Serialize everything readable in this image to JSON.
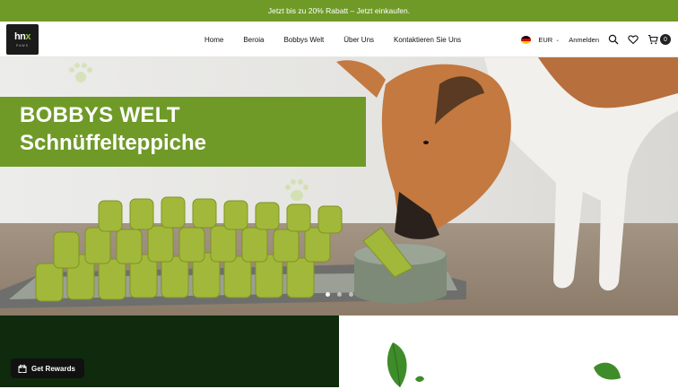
{
  "announcement": "Jetzt bis zu 20% Rabatt – Jetzt einkaufen.",
  "brand": {
    "logo_main": "hnx",
    "logo_sub": "PAWS"
  },
  "nav": {
    "items": [
      "Home",
      "Beroia",
      "Bobbys Welt",
      "Über Uns",
      "Kontaktieren Sie Uns"
    ]
  },
  "header_right": {
    "currency": "EUR",
    "login": "Anmelden",
    "cart_count": "0",
    "icons": [
      "search-icon",
      "heart-icon",
      "cart-icon"
    ]
  },
  "hero": {
    "line1": "BOBBYS WELT",
    "line2": "Schnüffelteppiche",
    "slides": 3,
    "active_slide": 1
  },
  "rewards": {
    "label": "Get Rewards"
  },
  "colors": {
    "brand_green": "#6f9a28",
    "dark_panel": "#0f2a0d",
    "black": "#111111"
  }
}
